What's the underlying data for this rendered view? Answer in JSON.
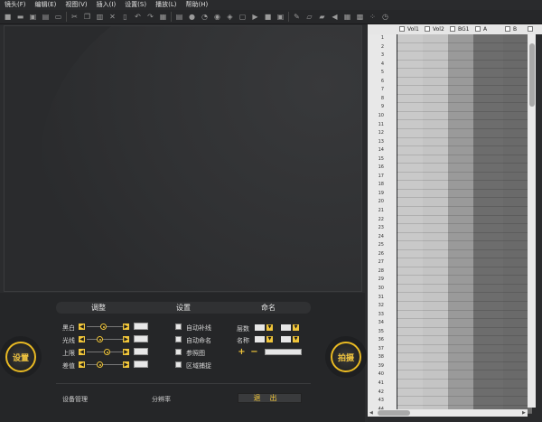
{
  "menu": [
    "镜头(F)",
    "编辑(E)",
    "视图(V)",
    "插入(I)",
    "设置(S)",
    "播放(L)",
    "帮助(H)"
  ],
  "toolbar_icons": [
    "camera-icon",
    "folder-open-icon",
    "save-icon",
    "save-as-icon",
    "print-icon",
    "cut-icon",
    "copy-icon",
    "paste-icon",
    "delete-icon",
    "trash-icon",
    "undo-icon",
    "redo-icon",
    "align-icon",
    "stack-icon",
    "sphere-icon",
    "clock-icon",
    "eye-icon",
    "node-icon",
    "crop-icon",
    "play-icon",
    "stop-icon",
    "frame-icon",
    "pencil-icon",
    "ruler-icon",
    "film-icon",
    "speaker-icon",
    "table-icon",
    "grid-icon",
    "dots-icon",
    "history-icon"
  ],
  "panel": {
    "tabs": [
      "调整",
      "设置",
      "命名"
    ],
    "settings_button": "设置",
    "capture_button": "拍摄",
    "adjust_rows": [
      {
        "label": "黑白",
        "level": 0.45
      },
      {
        "label": "光线",
        "level": 0.35
      },
      {
        "label": "上限",
        "level": 0.55
      },
      {
        "label": "差值",
        "level": 0.35
      }
    ],
    "checkboxes": [
      "自动补线",
      "自动命名",
      "参照图",
      "区域捕捉"
    ],
    "naming": {
      "layer_label": "层数",
      "name_label": "名称",
      "plus": "+",
      "minus": "−"
    },
    "device_label": "设备管理",
    "resolution_label": "分辨率",
    "exit_button": "退出"
  },
  "grid": {
    "columns": [
      "Vol1",
      "Vol2",
      "BG1",
      "A",
      "B"
    ],
    "rows": [
      "1",
      "2",
      "3",
      "4",
      "5",
      "6",
      "7",
      "8",
      "9",
      "10",
      "11",
      "12",
      "13",
      "14",
      "15",
      "16",
      "17",
      "18",
      "19",
      "20",
      "21",
      "22",
      "23",
      "24",
      "25",
      "26",
      "27",
      "28",
      "29",
      "30",
      "31",
      "32",
      "33",
      "34",
      "35",
      "36",
      "37",
      "38",
      "39",
      "40",
      "41",
      "42",
      "43",
      "44"
    ],
    "column_colors": [
      "#c9c9c9",
      "#c4c4c4",
      "#9a9a9a",
      "#6d6d6d",
      "#6a6a6a"
    ]
  },
  "colors": {
    "accent": "#f0c53a"
  }
}
